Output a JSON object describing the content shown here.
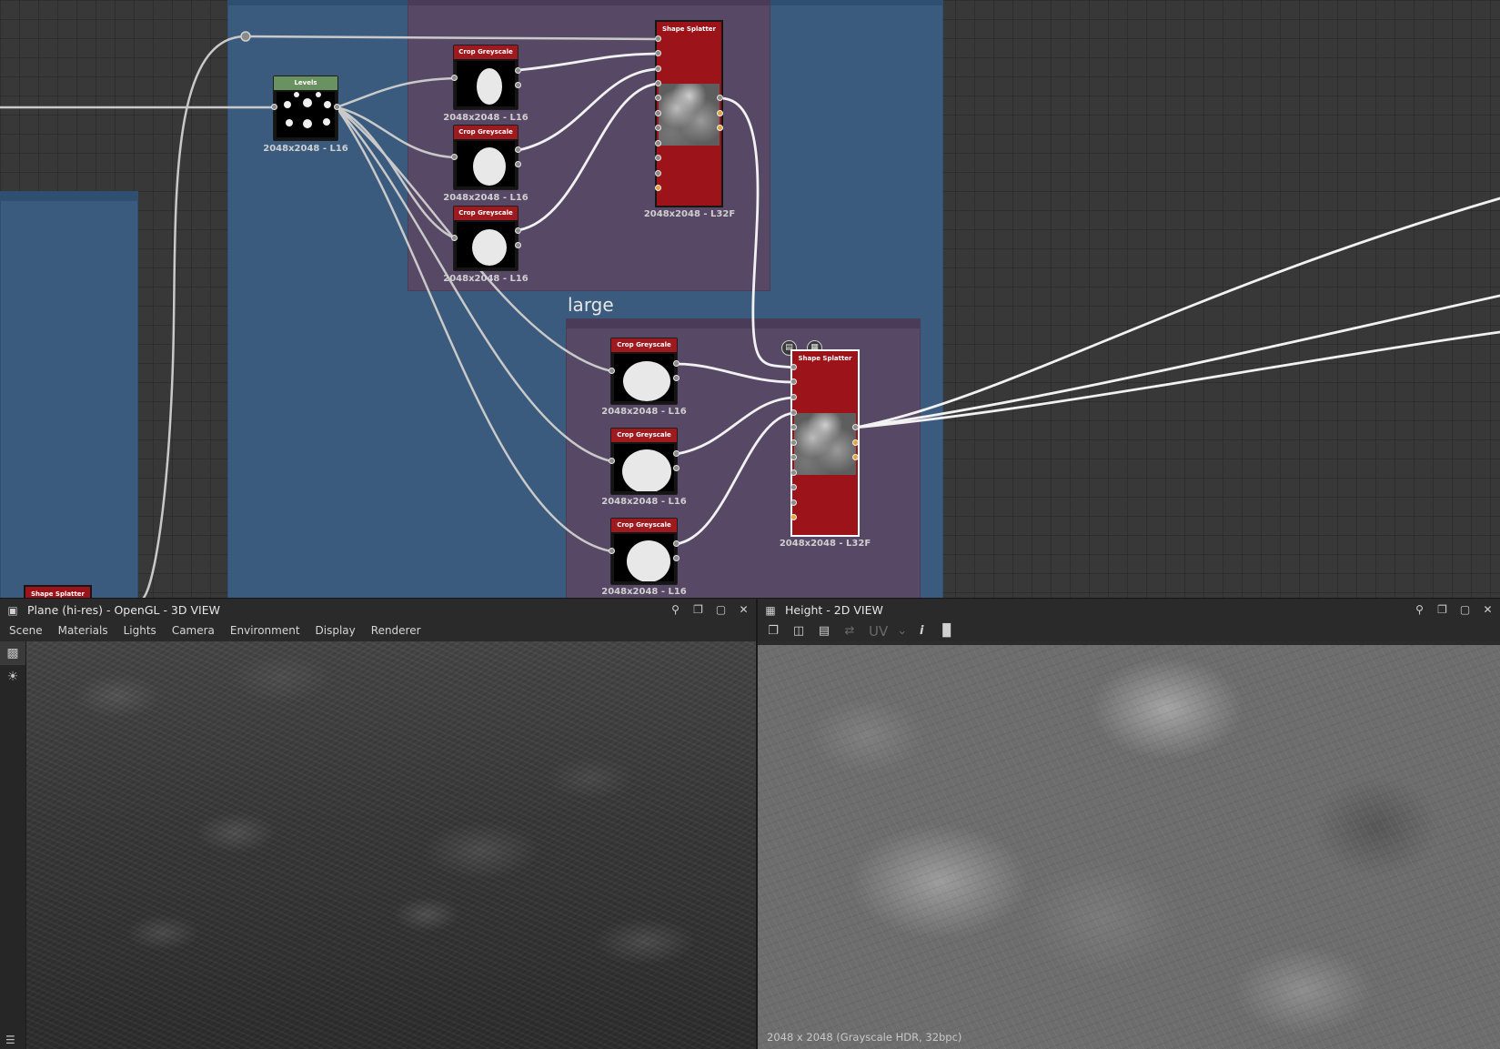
{
  "graph": {
    "frame_label_large": "large",
    "nodes": {
      "levels": {
        "title": "Levels",
        "label": "2048x2048 - L16"
      },
      "crop_1": {
        "title": "Crop Greyscale",
        "label": "2048x2048 - L16"
      },
      "crop_2": {
        "title": "Crop Greyscale",
        "label": "2048x2048 - L16"
      },
      "crop_3": {
        "title": "Crop Greyscale",
        "label": "2048x2048 - L16"
      },
      "splatter_top": {
        "title": "Shape Splatter",
        "label": "2048x2048 - L32F"
      },
      "crop_4": {
        "title": "Crop Greyscale",
        "label": "2048x2048 - L16"
      },
      "crop_5": {
        "title": "Crop Greyscale",
        "label": "2048x2048 - L16"
      },
      "crop_6": {
        "title": "Crop Greyscale",
        "label": "2048x2048 - L16"
      },
      "splatter_selected": {
        "title": "Shape Splatter",
        "label": "2048x2048 - L32F"
      },
      "splatter_left": {
        "title": "Shape Splatter"
      }
    },
    "colors": {
      "frame_blue": "#3a5b7e",
      "frame_purple": "#574866",
      "node_red": "#9f1a1e",
      "node_green": "#6a9160",
      "port_orange": "#e8a33c"
    }
  },
  "view3d": {
    "title": "Plane (hi-res) - OpenGL - 3D VIEW",
    "menu": [
      "Scene",
      "Materials",
      "Lights",
      "Camera",
      "Environment",
      "Display",
      "Renderer"
    ],
    "side_tools": [
      "camera-icon",
      "light-icon"
    ],
    "header_icons": [
      "pin-icon",
      "restore-icon",
      "maximize-icon",
      "close-icon"
    ]
  },
  "view2d": {
    "title": "Height - 2D VIEW",
    "toolbar": {
      "uv_label": "UV",
      "info_label": "i",
      "icons": [
        "copy-icon",
        "save-icon",
        "paste-icon",
        "share-icon",
        "info-icon",
        "histogram-icon"
      ]
    },
    "status": "2048 x 2048 (Grayscale HDR, 32bpc)",
    "header_icons": [
      "pin-icon",
      "restore-icon",
      "maximize-icon",
      "close-icon"
    ]
  }
}
